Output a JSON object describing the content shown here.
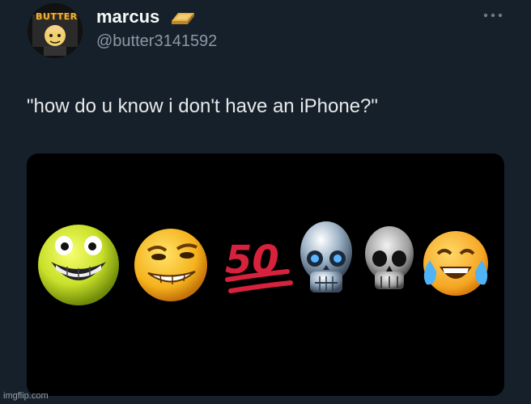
{
  "tweet": {
    "display_name": "marcus",
    "handle": "@butter3141592",
    "text": "\"how do u know i don't have an iPhone?\"",
    "avatar_text": "BUTTER"
  },
  "media": {
    "emoji_sequence": [
      "grinning-face-icon",
      "smirking-face-icon",
      "hundred-points-icon",
      "chrome-skull-icon",
      "skull-icon",
      "tears-of-joy-icon"
    ],
    "hundred_label": "50"
  },
  "watermark": "imgflip.com",
  "colors": {
    "background": "#16202b",
    "handle": "#8b98a5",
    "gold": "#d9a53a"
  }
}
